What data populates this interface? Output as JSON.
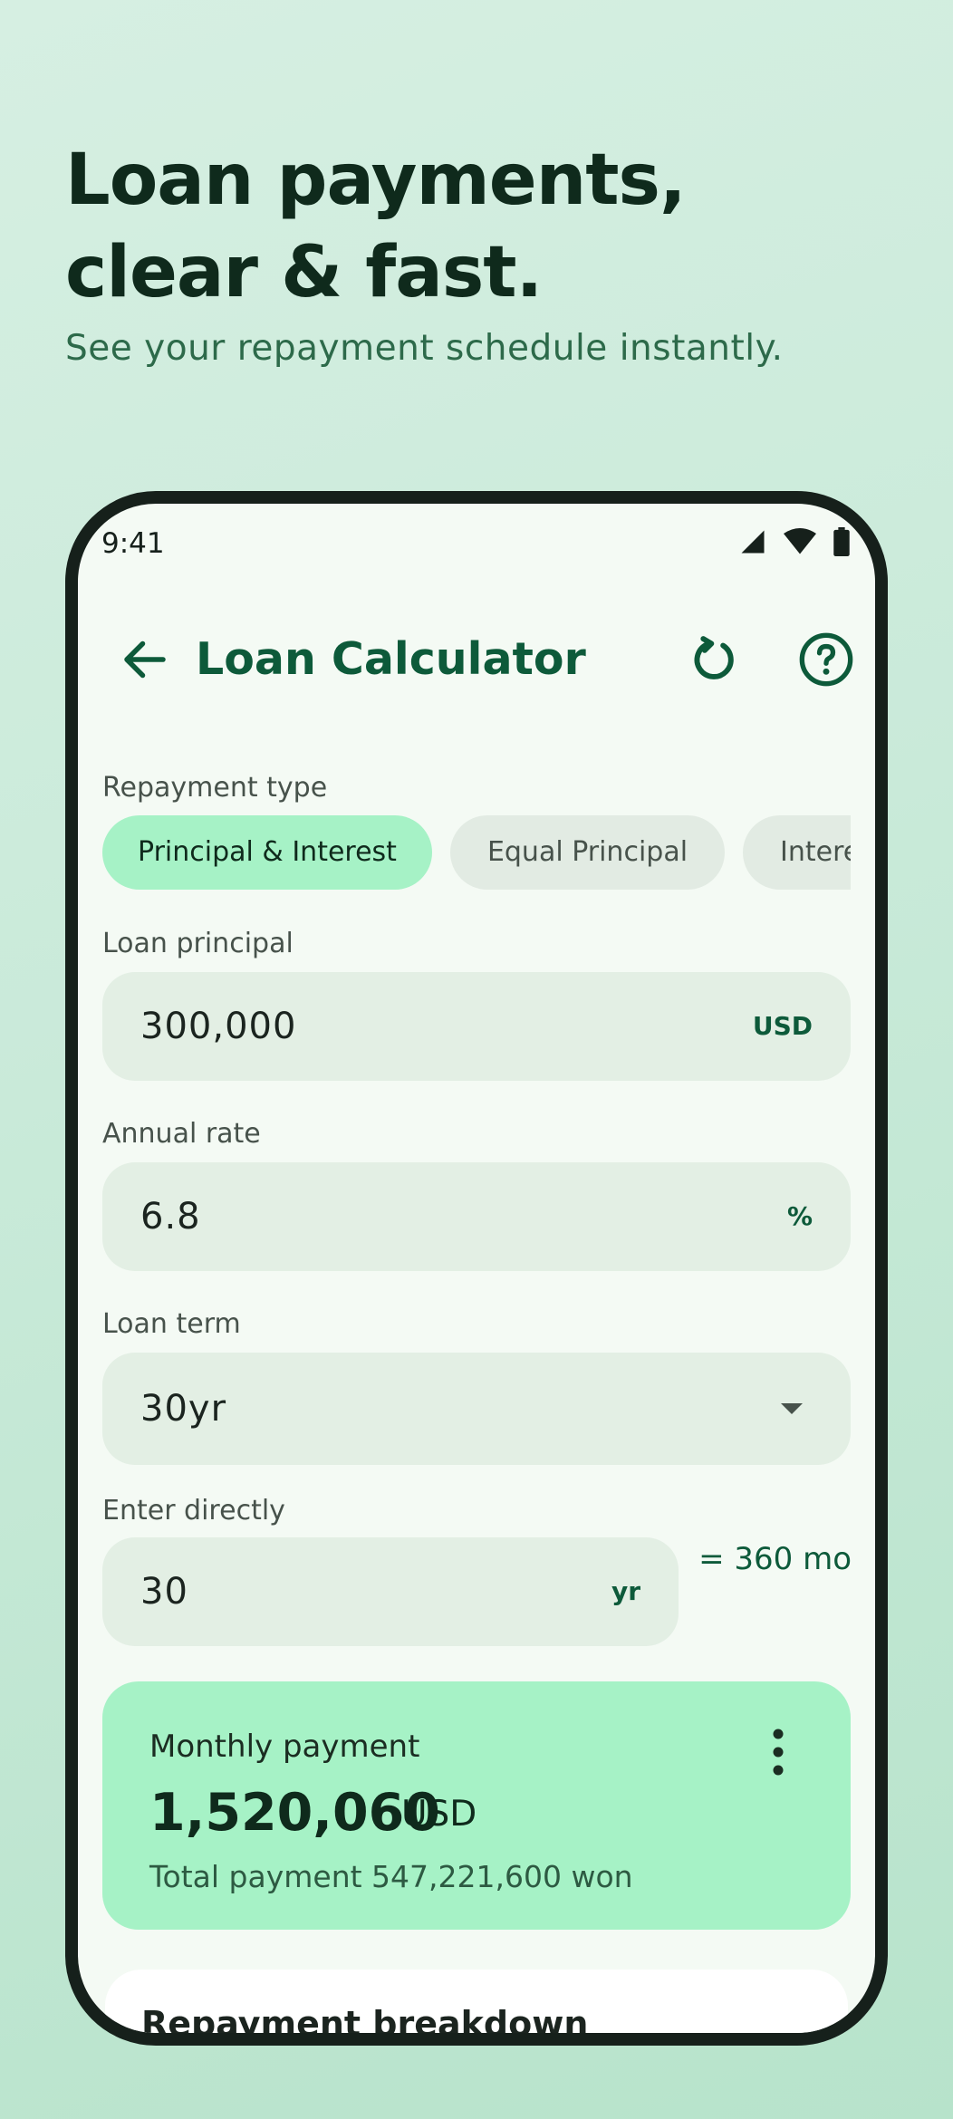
{
  "hero": {
    "title_line1": "Loan payments,",
    "title_line2": "clear & fast.",
    "subtitle": "See your repayment schedule instantly."
  },
  "status_bar": {
    "time": "9:41",
    "icons": [
      "signal-icon",
      "wifi-icon",
      "battery-icon"
    ]
  },
  "app_bar": {
    "title": "Loan Calculator",
    "actions": [
      "back-arrow-icon",
      "reset-icon",
      "help-icon"
    ]
  },
  "repayment_type": {
    "label": "Repayment type",
    "options": [
      "Principal & Interest",
      "Equal Principal",
      "Interest"
    ],
    "selected": "Principal & Interest"
  },
  "loan_principal": {
    "label": "Loan principal",
    "value": "300,000",
    "suffix": "USD"
  },
  "annual_rate": {
    "label": "Annual rate",
    "value": "6.8",
    "suffix": "%"
  },
  "loan_term": {
    "label": "Loan term",
    "value": "30yr",
    "icon": "dropdown-arrow-icon"
  },
  "enter_directly": {
    "label": "Enter directly",
    "value": "30",
    "suffix": "yr",
    "months": "= 360 mo"
  },
  "result": {
    "label": "Monthly payment",
    "amount": "1,520,060",
    "currency": "USD",
    "total": "Total payment 547,221,600 won"
  },
  "breakdown": {
    "title": "Repayment breakdown"
  },
  "colors": {
    "accent": "#0d5a3a",
    "chip_selected": "#a6f2c6",
    "field_bg": "#e3efe4",
    "screen_bg": "#f4faf4"
  }
}
